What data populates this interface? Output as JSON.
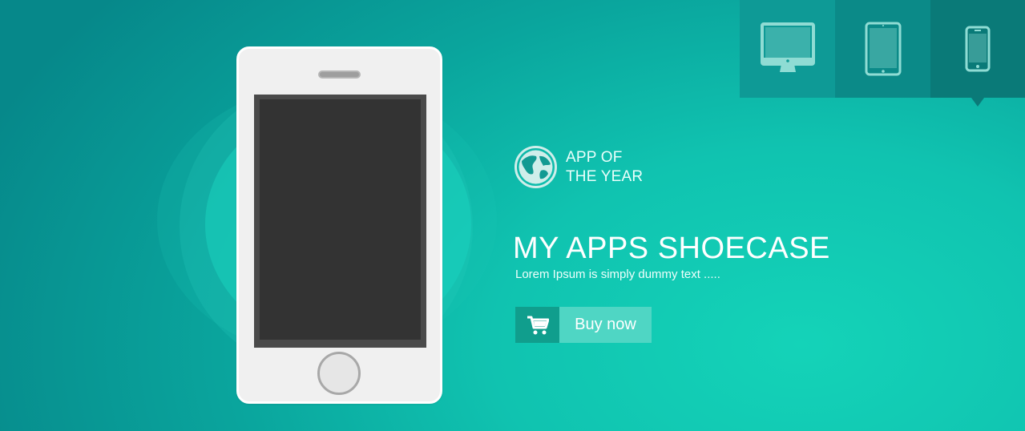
{
  "hero": {
    "badge_line1": "APP OF",
    "badge_line2": "THE YEAR",
    "headline": "MY APPS SHOECASE",
    "subtext": "Lorem Ipsum is simply dummy text .....",
    "buy_label": "Buy now"
  },
  "device_switcher": {
    "tabs": [
      {
        "name": "desktop",
        "icon": "desktop-icon",
        "active": false
      },
      {
        "name": "tablet",
        "icon": "tablet-icon",
        "active": false
      },
      {
        "name": "phone",
        "icon": "phone-icon",
        "active": true
      }
    ]
  },
  "colors": {
    "background_light": "#14d3b8",
    "background_dark": "#06888a",
    "buy_icon_bg": "#109e8d",
    "buy_label_bg": "#4fd6c4",
    "icon_tint": "#8fdcd4",
    "phone_body": "#f0f0f0",
    "phone_screen": "#333333"
  }
}
